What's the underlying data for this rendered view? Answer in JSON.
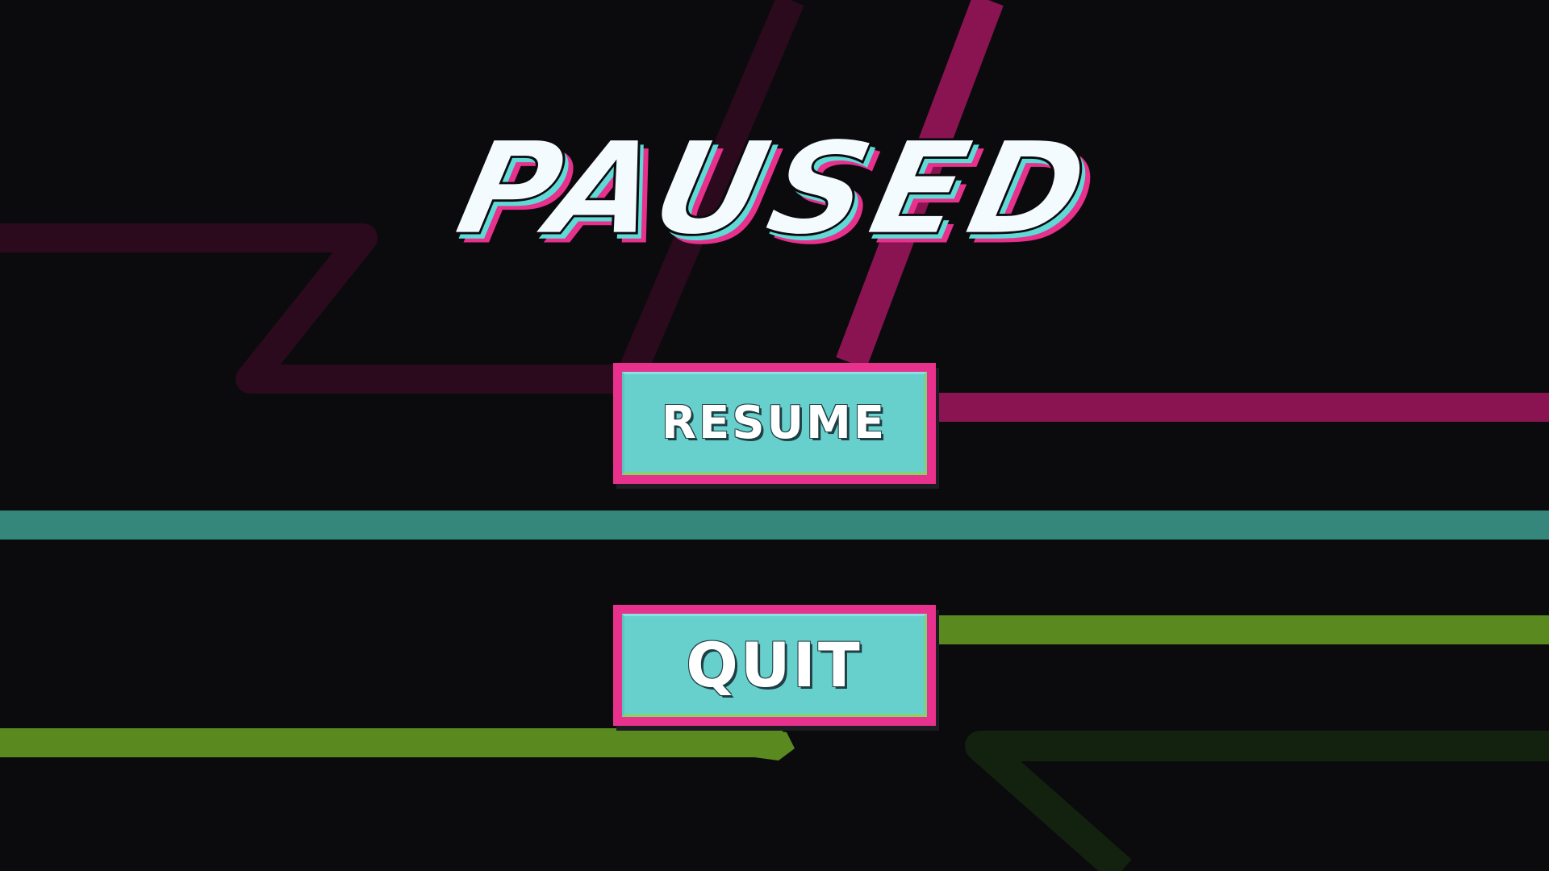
{
  "screen": "pause-menu",
  "title": "PAUSED",
  "buttons": {
    "resume_label": "RESUME",
    "quit_label": "QUIT"
  },
  "colors": {
    "background": "#0b0b0e",
    "accent_pink": "#e8308d",
    "accent_teal": "#67d0cc",
    "title_white": "#f4fbff",
    "stripe_magenta": "#8a1452",
    "stripe_dark_magenta": "#2a0a1c",
    "stripe_teal": "#34877a",
    "stripe_green": "#5a8a1f",
    "stripe_dark_green": "#13220f"
  }
}
